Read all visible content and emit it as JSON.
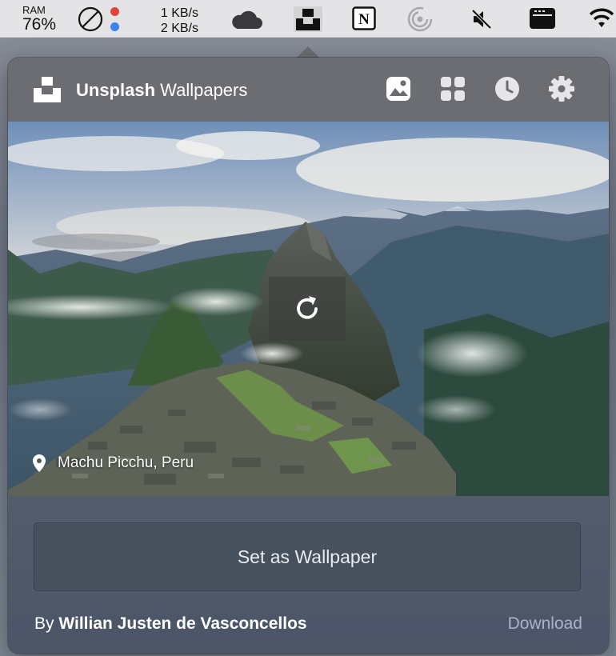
{
  "menubar": {
    "ram_label": "RAM",
    "ram_value": "76%",
    "net_up": "1 KB/s",
    "net_down": "2 KB/s",
    "icons": [
      "do-not-disturb-icon",
      "status-dots-icon",
      "cloud-icon",
      "unsplash-icon",
      "notion-icon",
      "gauge-icon",
      "mute-icon",
      "terminal-icon",
      "wifi-icon"
    ],
    "notion_letter": "N",
    "dot_colors": [
      "#e0443c",
      "#3b82f6"
    ]
  },
  "app": {
    "title_bold": "Unsplash",
    "title_rest": " Wallpapers",
    "header_icons": [
      "photo-icon",
      "grid-icon",
      "clock-icon",
      "gear-icon"
    ]
  },
  "photo": {
    "location": "Machu Picchu, Peru"
  },
  "actions": {
    "set_wallpaper": "Set as Wallpaper",
    "by_prefix": "By ",
    "author": "Willian Justen de Vasconcellos",
    "download": "Download"
  },
  "colors": {
    "header_bg": "#6b6d72",
    "panel_bg": "#4e5869",
    "download_link": "#a7b3c6"
  }
}
